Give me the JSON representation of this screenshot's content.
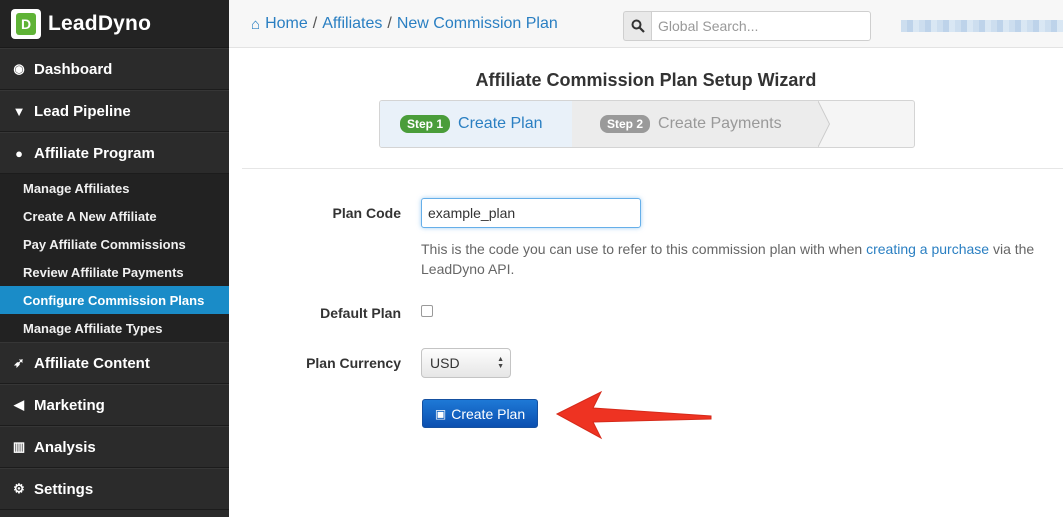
{
  "brand": {
    "logo_letter": "D",
    "name": "LeadDyno",
    "accent": "#5fb336"
  },
  "sidebar": {
    "top_items": [
      {
        "label": "Dashboard",
        "icon": "dashboard-icon"
      },
      {
        "label": "Lead Pipeline",
        "icon": "filter-icon"
      },
      {
        "label": "Affiliate Program",
        "icon": "user-icon"
      }
    ],
    "sub_items": [
      {
        "label": "Manage Affiliates",
        "active": false
      },
      {
        "label": "Create A New Affiliate",
        "active": false
      },
      {
        "label": "Pay Affiliate Commissions",
        "active": false
      },
      {
        "label": "Review Affiliate Payments",
        "active": false
      },
      {
        "label": "Configure Commission Plans",
        "active": true
      },
      {
        "label": "Manage Affiliate Types",
        "active": false
      }
    ],
    "bottom_items": [
      {
        "label": "Affiliate Content",
        "icon": "rocket-icon"
      },
      {
        "label": "Marketing",
        "icon": "megaphone-icon"
      },
      {
        "label": "Analysis",
        "icon": "bar-chart-icon"
      },
      {
        "label": "Settings",
        "icon": "gears-icon"
      }
    ],
    "active_color": "#1a8cc8"
  },
  "breadcrumb": {
    "home": "Home",
    "affiliates": "Affiliates",
    "current": "New Commission Plan",
    "separator": "/"
  },
  "search": {
    "placeholder": "Global Search..."
  },
  "wizard": {
    "title": "Affiliate Commission Plan Setup Wizard",
    "step1": {
      "badge": "Step 1",
      "label": "Create Plan"
    },
    "step2": {
      "badge": "Step 2",
      "label": "Create Payments"
    }
  },
  "form": {
    "plan_code_label": "Plan Code",
    "plan_code_value": "example_plan",
    "help_before": "This is the code you can use to refer to this commission plan with when ",
    "help_link": "creating a purchase",
    "help_after": " via the LeadDyno API.",
    "default_plan_label": "Default Plan",
    "default_plan_checked": false,
    "currency_label": "Plan Currency",
    "currency_value": "USD",
    "submit_label": "Create Plan"
  },
  "annotation": {
    "arrow_color": "#ee3322"
  }
}
